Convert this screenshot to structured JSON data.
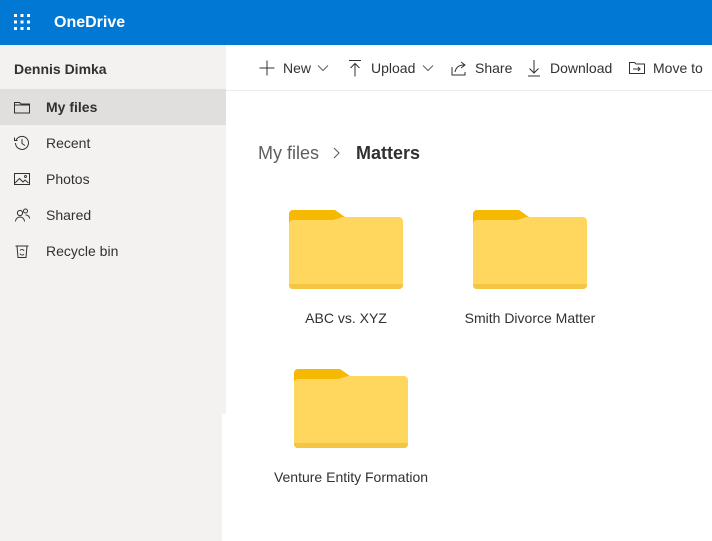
{
  "header": {
    "app_name": "OneDrive",
    "waffle_icon": "app-launcher-icon",
    "brand_color": "#0078d4"
  },
  "sidebar": {
    "user_name": "Dennis Dimka",
    "items": [
      {
        "label": "My files",
        "icon": "folder-icon",
        "selected": true
      },
      {
        "label": "Recent",
        "icon": "history-icon",
        "selected": false
      },
      {
        "label": "Photos",
        "icon": "photo-icon",
        "selected": false
      },
      {
        "label": "Shared",
        "icon": "people-icon",
        "selected": false
      },
      {
        "label": "Recycle bin",
        "icon": "recycle-bin-icon",
        "selected": false
      }
    ]
  },
  "commandbar": {
    "new_label": "New",
    "upload_label": "Upload",
    "share_label": "Share",
    "download_label": "Download",
    "move_label": "Move to"
  },
  "breadcrumb": {
    "root": "My files",
    "current": "Matters"
  },
  "folders": [
    {
      "name": "ABC vs. XYZ"
    },
    {
      "name": "Smith Divorce Matter"
    },
    {
      "name": "Venture Entity Formation"
    }
  ],
  "colors": {
    "folder_back": "#f7b801",
    "folder_front": "#ffd75e",
    "selected_nav": "#e1dfdd",
    "sidebar_bg": "#f3f2f1"
  }
}
